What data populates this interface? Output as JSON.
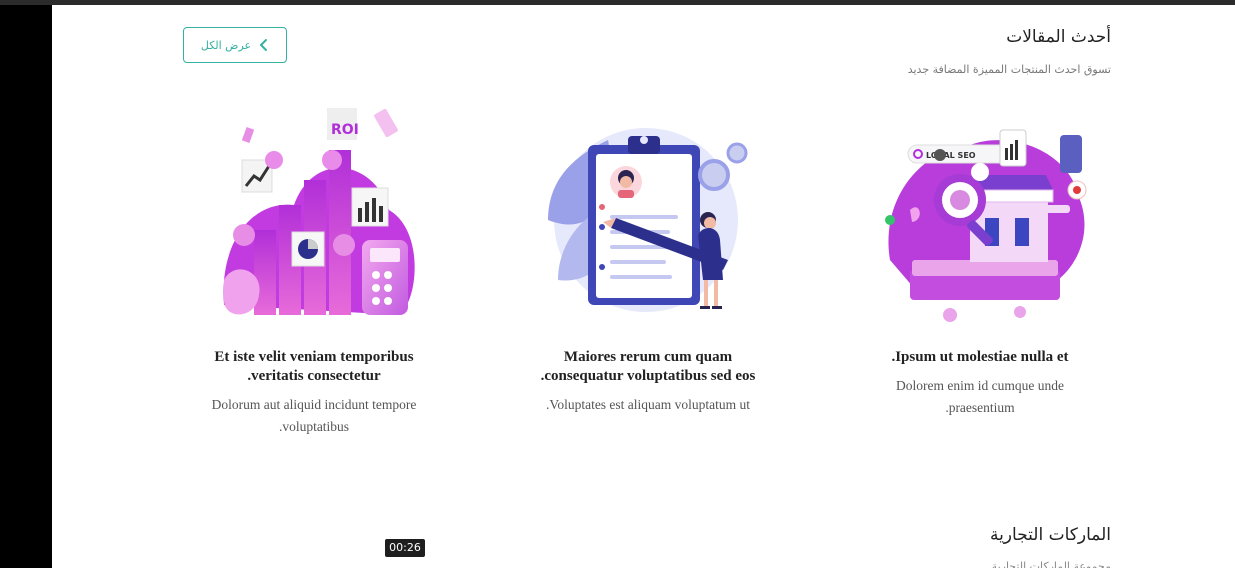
{
  "articles": {
    "heading": "أحدث المقالات",
    "subheading": "تسوق احدث المنتجات المميزة المضافة جديد",
    "view_all_label": "عرض الكل",
    "cards": [
      {
        "image": "finance-charts-illustration",
        "title": "Et iste velit veniam temporibus veritatis consectetur.",
        "description": "Dolorum aut aliquid incidunt tempore voluptatibus."
      },
      {
        "image": "clipboard-woman-pencil-illustration",
        "title": "Maiores rerum cum quam consequatur voluptatibus sed eos.",
        "description": "Voluptates est aliquam voluptatum ut."
      },
      {
        "image": "local-seo-shop-illustration",
        "image_text": "LOCAL SEO",
        "title": "Ipsum ut molestiae nulla et.",
        "description": "Dolorem enim id cumque unde praesentium."
      }
    ]
  },
  "brands": {
    "heading": "الماركات التجارية",
    "subheading": "مجموعة الماركات التجارية"
  },
  "video_timer": "00:26",
  "colors": {
    "accent": "#35b1a1",
    "purple": "#a63bd6",
    "magenta": "#e04fd0",
    "navy": "#2c2f8c"
  }
}
